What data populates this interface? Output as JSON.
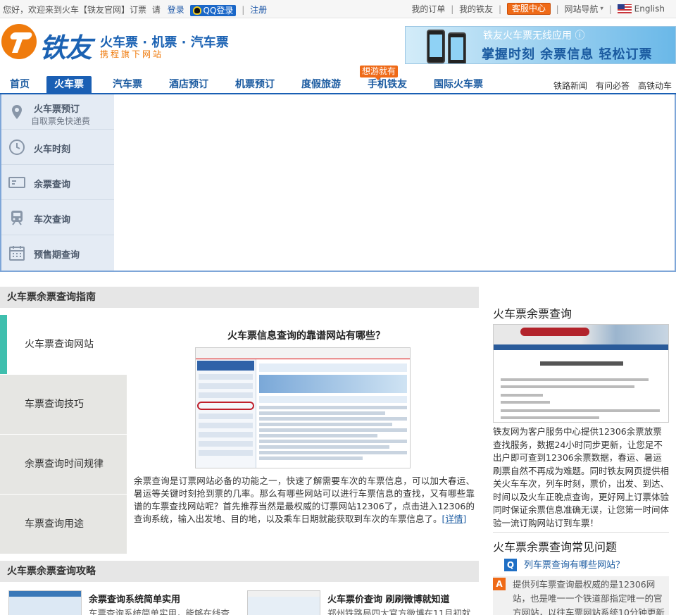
{
  "topbar": {
    "greeting": "您好，欢迎来到火车【铁友官网】订票",
    "please": "请",
    "login": "登录",
    "qq_login": "QQ登录",
    "register": "注册",
    "my_orders": "我的订单",
    "my_tieyou": "我的铁友",
    "service_center": "客服中心",
    "site_nav": "网站导航",
    "language": "English"
  },
  "header": {
    "logo": "铁友",
    "tagline": "火车票 · 机票 · 汽车票",
    "subtag": "携程旗下网站",
    "banner_line1": "铁友火车票无线应用 ⓘ",
    "banner_line2": "掌握时刻  余票信息  轻松订票"
  },
  "nav": {
    "items": [
      "首页",
      "火车票",
      "汽车票",
      "酒店预订",
      "机票预订",
      "度假旅游",
      "手机铁友",
      "国际火车票"
    ],
    "hot_badge": "想游就有",
    "side_links": [
      "铁路新闻",
      "有问必答",
      "高铁动车"
    ]
  },
  "search_menu": [
    {
      "title": "火车票预订",
      "sub": "自取票免快递费",
      "icon": "location-pin-icon"
    },
    {
      "title": "火车时刻",
      "sub": "",
      "icon": "clock-icon"
    },
    {
      "title": "余票查询",
      "sub": "",
      "icon": "ticket-icon"
    },
    {
      "title": "车次查询",
      "sub": "",
      "icon": "train-icon"
    },
    {
      "title": "预售期查询",
      "sub": "",
      "icon": "calendar-icon"
    }
  ],
  "guide": {
    "heading": "火车票余票查询指南",
    "tabs": [
      "火车票查询网站",
      "车票查询技巧",
      "余票查询时间规律",
      "车票查询用途"
    ],
    "article_title": "火车票信息查询的靠谱网站有哪些？",
    "article_body": "余票查询是订票网站必备的功能之一，快速了解需要车次的车票信息，可以加大春运、暑运等关键时刻抢到票的几率。那么有哪些网站可以进行车票信息的查找，又有哪些靠谱的车票查找网站呢？首先推荐当然是最权威的订票网站12306了，点击进入12306的查询系统，输入出发地、目的地，以及乘车日期就能获取到车次的车票信息了。",
    "more": "[详情]"
  },
  "strategy": {
    "heading": "火车票余票查询攻略",
    "items": [
      {
        "title": "余票查询系统简单实用",
        "desc": "车票查询系统简单实用，能够在线查"
      },
      {
        "title": "火车票价查询 刷刷微博就知道",
        "desc": "郑州铁路局四大官方微博在11月初就"
      }
    ]
  },
  "right": {
    "title": "火车票余票查询",
    "desc": "铁友网为客户服务中心提供12306余票放票查找服务，数据24小时同步更新，让您足不出户即可查到12306余票数据，春运、暑运刷票自然不再成为难题。同时铁友网页提供相关火车车次，列车时刻，票价，出发、到达、时间以及火车正晚点查询，更好网上订票体验同时保证余票信息准确无误，让您第一时间体验一流订购网站订到车票！",
    "faq_title": "火车票余票查询常见问题",
    "q_badge": "Q",
    "question": "列车票查询有哪些网站？",
    "a_badge": "A",
    "answer": "提供列车票查询最权威的是12306网站，也是唯一一个铁道部指定唯一的官方网站，以往车票网站系统10分钟更新"
  },
  "colors": {
    "brand_blue": "#1a5fb4",
    "brand_orange": "#ef7b0d",
    "accent_teal": "#3fbfae"
  }
}
